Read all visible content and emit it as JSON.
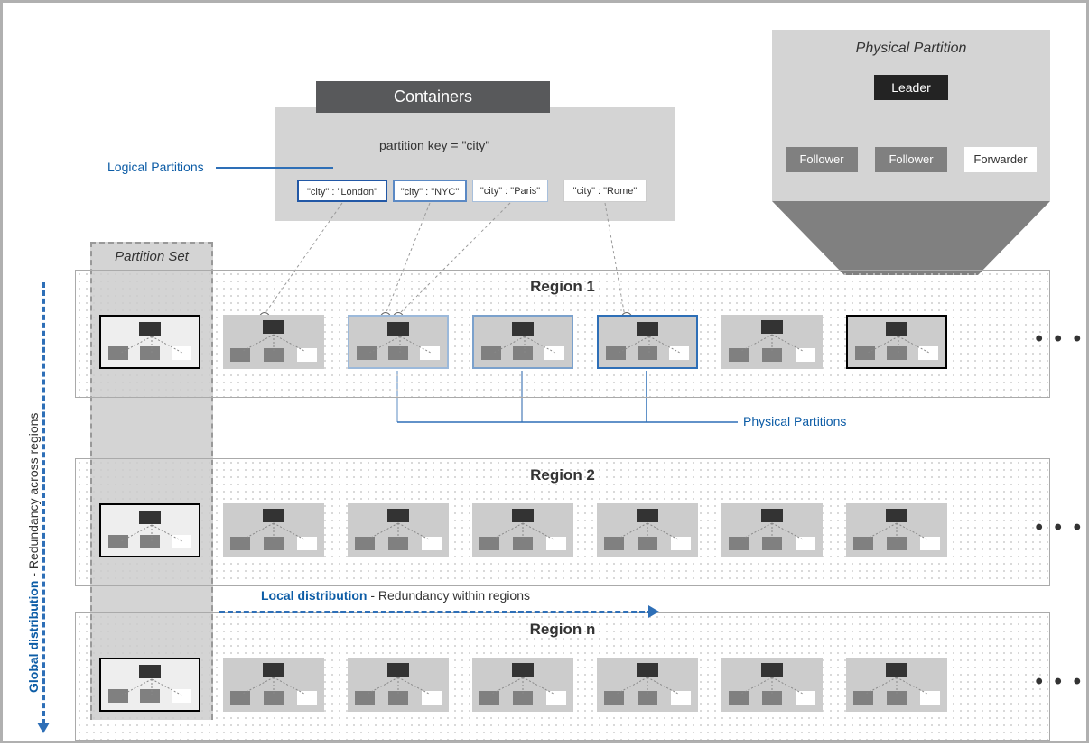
{
  "containers": {
    "title": "Containers",
    "partition_key_label": "partition key = \"city\"",
    "logical_label": "Logical Partitions",
    "cities": {
      "c1": "\"city\" : \"London\"",
      "c2": "\"city\" : \"NYC\"",
      "c3": "\"city\" : \"Paris\"",
      "c4": "\"city\" : \"Rome\""
    }
  },
  "physical_detail": {
    "title": "Physical Partition",
    "leader": "Leader",
    "follower1": "Follower",
    "follower2": "Follower",
    "forwarder": "Forwarder"
  },
  "partition_set_label": "Partition Set",
  "regions": {
    "r1": "Region 1",
    "r2": "Region 2",
    "r3": "Region n",
    "ellipsis": "• • •"
  },
  "physical_partitions_label": "Physical Partitions",
  "global_distribution": {
    "bold": "Global distribution",
    "rest": "  -  Redundancy across regions"
  },
  "local_distribution": {
    "bold": "Local distribution",
    "rest": "  -  Redundancy within regions"
  }
}
